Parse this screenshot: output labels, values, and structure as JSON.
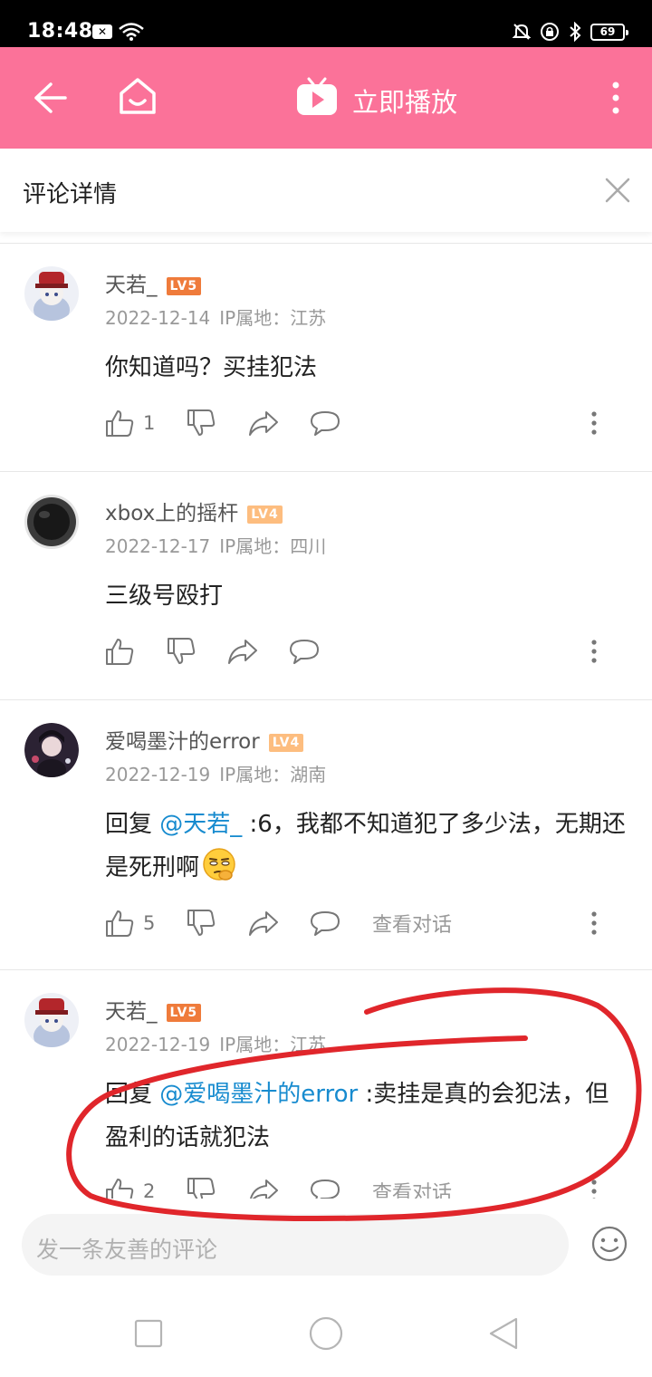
{
  "status_bar": {
    "time": "18:48",
    "battery": "69"
  },
  "header": {
    "title": "立即播放"
  },
  "sub_header": {
    "title": "评论详情"
  },
  "comments": [
    {
      "username": "天若_",
      "level": "LV5",
      "date": "2022-12-14",
      "ip": "IP属地：江苏",
      "text": "你知道吗？买挂犯法",
      "likes": "1"
    },
    {
      "username": "xbox上的摇杆",
      "level": "LV4",
      "date": "2022-12-17",
      "ip": "IP属地：四川",
      "text": "三级号殴打",
      "likes": ""
    },
    {
      "username": "爱喝墨汁的error",
      "level": "LV4",
      "date": "2022-12-19",
      "ip": "IP属地：湖南",
      "reply_prefix": "回复 ",
      "mention": "@天若_",
      "text": ":6，我都不知道犯了多少法，无期还是死刑啊",
      "emoji": "thinking-face-emoji",
      "likes": "5",
      "view_dialog": "查看对话"
    },
    {
      "username": "天若_",
      "level": "LV5",
      "date": "2022-12-19",
      "ip": "IP属地：江苏",
      "reply_prefix": "回复 ",
      "mention": "@爱喝墨汁的error",
      "text": ":卖挂是真的会犯法，但盈利的话就犯法",
      "likes": "2",
      "view_dialog": "查看对话"
    }
  ],
  "input": {
    "placeholder": "发一条友善的评论"
  },
  "colors": {
    "brand_pink": "#fb7299",
    "mention_blue": "#178bcf",
    "lv5": "#ef7b3b",
    "lv4": "#fdbd7f",
    "annotation_red": "#e0262b"
  }
}
